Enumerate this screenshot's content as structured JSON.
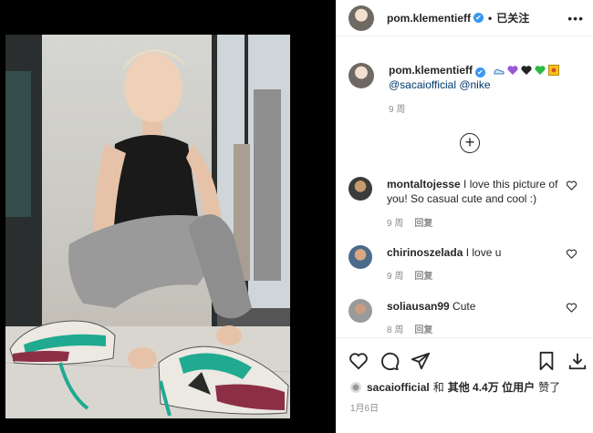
{
  "header": {
    "username": "pom.klementieff",
    "verified_mark": "✔",
    "dot": "•",
    "follow_label": "已关注",
    "more_label": "•••"
  },
  "caption": {
    "username": "pom.klementieff",
    "mentions": "@sacaiofficial @nike",
    "emoji_icons": [
      "shoe-icon",
      "purple-heart-icon",
      "black-heart-icon",
      "green-heart-icon",
      "yellow-square-icon"
    ],
    "time": "9 周"
  },
  "comments": [
    {
      "username": "montaltojesse",
      "text": "I love this picture of you! So casual cute and cool :)",
      "time": "9 周",
      "reply": "回复"
    },
    {
      "username": "chirinoszelada",
      "text": "I love u",
      "time": "9 周",
      "reply": "回复"
    },
    {
      "username": "soliausan99",
      "text": "Cute",
      "time": "8 周",
      "reply": "回复"
    }
  ],
  "likes": {
    "user": "sacaiofficial",
    "joiner": "和",
    "others": "其他 4.4万 位用户",
    "suffix": "赞了"
  },
  "date": "1月6日",
  "colors": {
    "link": "#00376b",
    "verified": "#3897f0",
    "muted": "#8e8e8e",
    "teal_shoe": "#1faa91",
    "burgundy_shoe": "#8c2f45"
  }
}
